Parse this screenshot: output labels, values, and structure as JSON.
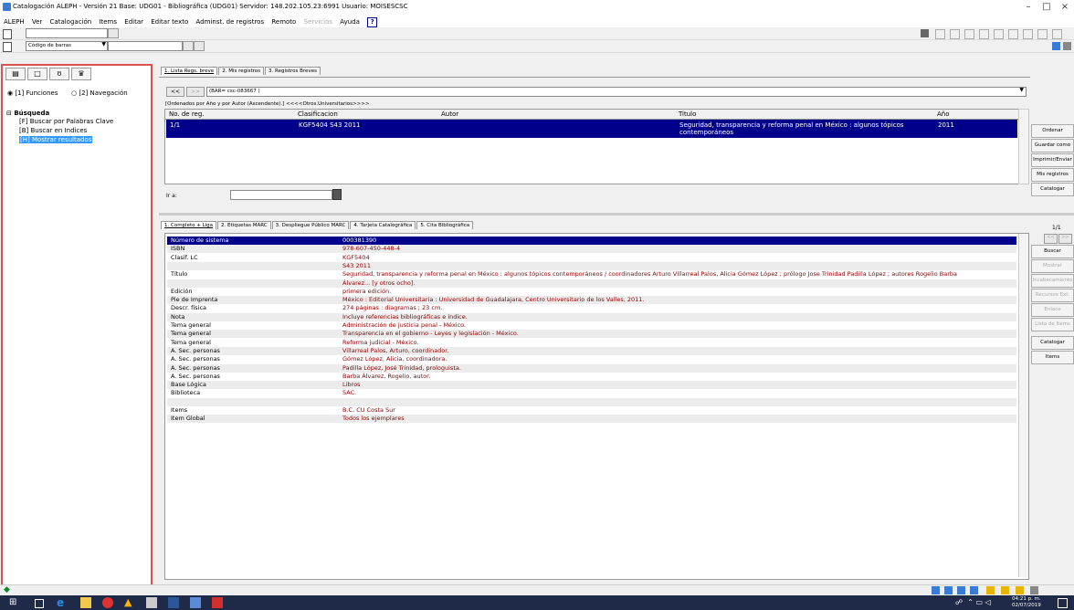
{
  "window": {
    "title": "Catalogación ALEPH - Versión 21  Base: UDG01 - Bibliográfica (UDG01)  Servidor: 148.202.105.23:6991  Usuario: MOISESCSC",
    "min": "–",
    "max": "□",
    "close": "×"
  },
  "menu": [
    "ALEPH",
    "Ver",
    "Catalogación",
    "Items",
    "Editar",
    "Editar texto",
    "Adminst. de registros",
    "Remoto",
    "Servicios",
    "Ayuda"
  ],
  "toolbar2": {
    "dropdown_value": "Código de barras"
  },
  "left": {
    "radio1": "[1] Funciones",
    "radio2": "[2] Navegación",
    "tree_root": "Búsqueda",
    "items": [
      "[F] Buscar por Palabras Clave",
      "[B] Buscar en Indices",
      "[H] Mostrar resultados"
    ]
  },
  "top_tabs": [
    "1. Lista Regs. breve",
    "2. Mis registros",
    "3. Registros Breves"
  ],
  "nav": {
    "prev": "<<",
    "next": ">>",
    "query": "(BAR= csc-083667 )"
  },
  "sort_text": "[Ordenados por Año y por Autor (Ascendente).]  <<<<Otros.Universitarios>>>>",
  "list": {
    "headers": [
      "No. de reg.",
      "Clasificacion",
      "Autor",
      "Titulo",
      "Año"
    ],
    "row": {
      "no": "1/1",
      "clas": "KGF5404 S43 2011",
      "autor": "",
      "titulo": "Seguridad, transparencia y reforma penal en México : algunos tópicos contemporáneos",
      "anio": "2011"
    }
  },
  "goto_label": "Ir a:",
  "right_btns1": [
    "Ordenar",
    "Guardar como",
    "Imprimir/Enviar",
    "Mis registros",
    "Catalogar"
  ],
  "bottom_tabs": [
    "1. Completo + Liga",
    "2. Etiquetas MARC",
    "3. Despliegue Público MARC",
    "4. Tarjeta Catalográfica",
    "5. Cita Bibliográfica"
  ],
  "counter": "1/1",
  "right_btns2": [
    "Buscar",
    "Mostrar",
    "Incabecamiento",
    "Recursos Ext.",
    "Enlace",
    "Lista de Items",
    "Catalogar",
    "Items"
  ],
  "record": [
    {
      "label": "Número de sistema",
      "value": "000381390"
    },
    {
      "label": "ISBN",
      "value": "978-607-450-448-4"
    },
    {
      "label": "Clasif. LC",
      "value": "KGF5404"
    },
    {
      "label": "",
      "value": "S43 2011"
    },
    {
      "label": "Título",
      "value": "Seguridad, transparencia y reforma penal en México : algunos tópicos contemporáneos / coordinadores Arturo Villarreal Palos, Alicia Gómez López ; prólogo Jose Trinidad Padilla López ; autores Rogelio Barba"
    },
    {
      "label": "",
      "value": "Álvarez... [y otros ocho]."
    },
    {
      "label": "Edición",
      "value": "primera edición."
    },
    {
      "label": "Pie de Imprenta",
      "value": "México : Editorial Universitaria : Universidad de Guadalajara, Centro Universitario de los Valles, 2011."
    },
    {
      "label": "Descr. física",
      "value": "274 páginas : diagramas ; 23 cm."
    },
    {
      "label": "Nota",
      "value": "Incluye referencias bibliográficas e índice."
    },
    {
      "label": "Tema general",
      "value": "Administración de justicia penal - México."
    },
    {
      "label": "Tema general",
      "value": "Transparencia en el gobierno - Leyes y legislación - México."
    },
    {
      "label": "Tema general",
      "value": "Reforma judicial - México."
    },
    {
      "label": "A. Sec. personas",
      "value": "Villarreal Palos, Arturo, coordinador."
    },
    {
      "label": "A. Sec. personas",
      "value": "Gómez López, Alicia, coordinadora."
    },
    {
      "label": "A. Sec. personas",
      "value": "Padilla López, José Trinidad, prologuista."
    },
    {
      "label": "A. Sec. personas",
      "value": "Barba Álvarez, Rogelio, autor."
    },
    {
      "label": "Base Lógica",
      "value": "Libros"
    },
    {
      "label": "Biblioteca",
      "value": "SAC."
    },
    {
      "label": "",
      "value": ""
    },
    {
      "label": "Items",
      "value": "B.C. CU Costa Sur"
    },
    {
      "label": "Item Global",
      "value": "Todos los ejemplares"
    }
  ],
  "clock": {
    "time": "04:21 p. m.",
    "date": "02/07/2019"
  }
}
